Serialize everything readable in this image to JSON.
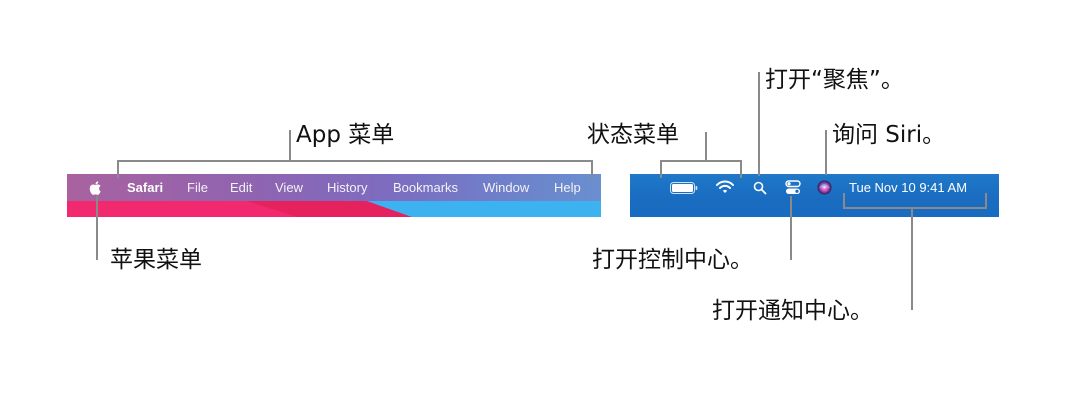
{
  "menubar": {
    "apple_icon": "apple-logo-icon",
    "app_name": "Safari",
    "menus": [
      "File",
      "Edit",
      "View",
      "History",
      "Bookmarks",
      "Window",
      "Help"
    ]
  },
  "status_bar": {
    "icons": [
      "battery-icon",
      "wifi-icon",
      "spotlight-search-icon",
      "control-center-icon",
      "siri-icon"
    ],
    "datetime": "Tue Nov 10  9:41 AM"
  },
  "callouts": {
    "app_menu": "App 菜单",
    "status_menu": "状态菜单",
    "spotlight": "打开“聚焦”。",
    "siri": "询问 Siri。",
    "apple_menu": "苹果菜单",
    "control_center": "打开控制中心。",
    "notification_center": "打开通知中心。"
  },
  "colors": {
    "left_bar_gradient": [
      "#a9629f",
      "#6a8fcf"
    ],
    "right_bar": "#1a6cc0",
    "leader_line": "#8a8a8a"
  }
}
